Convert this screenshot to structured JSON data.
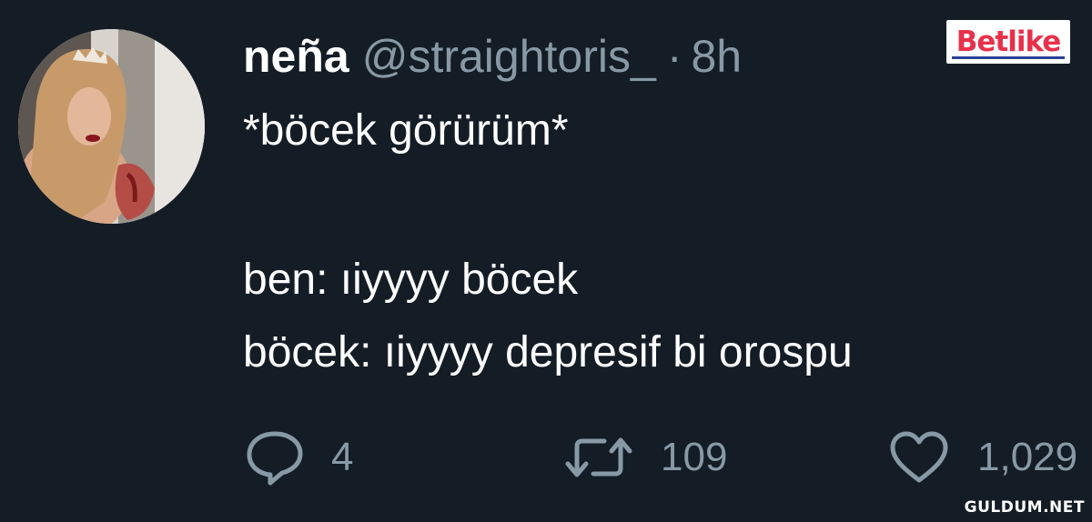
{
  "tweet": {
    "author": {
      "name": "neña",
      "handle": "@straightoris_",
      "separator": "·",
      "time": "8h"
    },
    "text_lines": [
      "*böcek görürüm*",
      "ben: ıiyyyy böcek",
      "böcek: ıiyyyy depresif bi orospu"
    ],
    "actions": {
      "reply": {
        "icon": "reply-icon",
        "count": "4"
      },
      "retweet": {
        "icon": "retweet-icon",
        "count": "109"
      },
      "like": {
        "icon": "heart-icon",
        "count": "1,029"
      }
    }
  },
  "overlays": {
    "logo_text": "Betlike",
    "watermark": "GULDUM.NET"
  },
  "colors": {
    "background": "#141d26",
    "primary_text": "#ffffff",
    "secondary_text": "#8899a6",
    "logo_red": "#e8304a",
    "logo_blue": "#2b3e9a"
  }
}
